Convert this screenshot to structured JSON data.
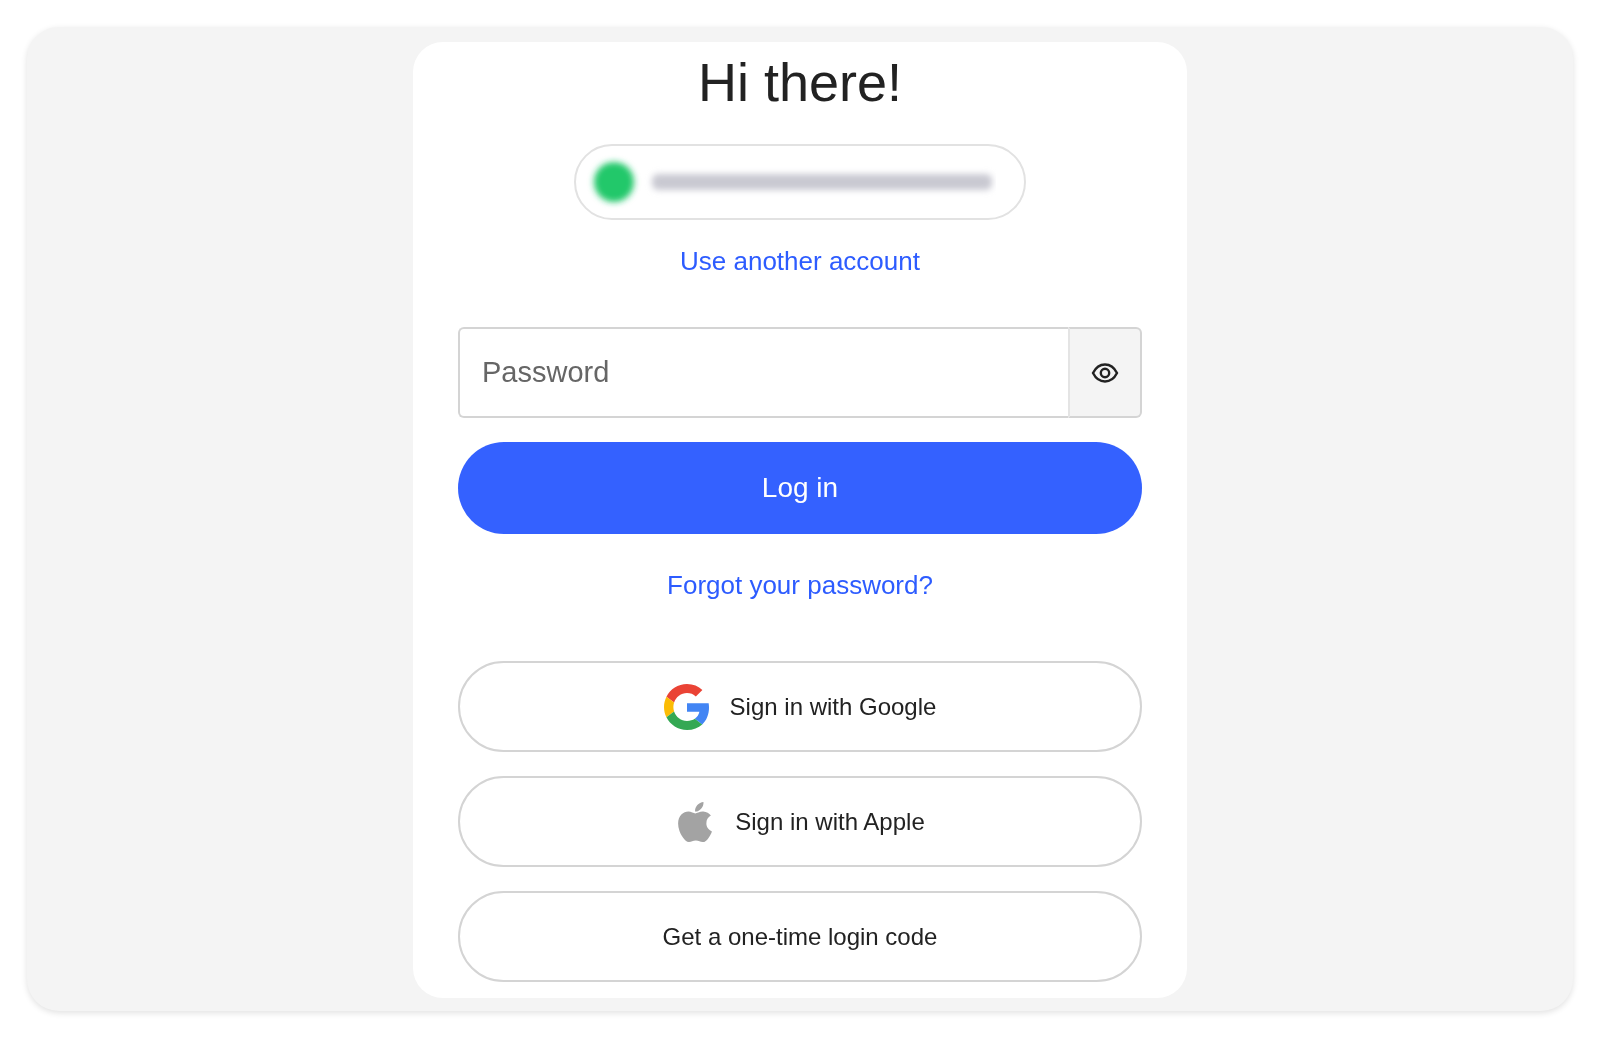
{
  "heading": "Hi there!",
  "switch_account_link": "Use another account",
  "password_field": {
    "placeholder": "Password"
  },
  "login_button": "Log in",
  "forgot_link": "Forgot your password?",
  "alt_sign_in": [
    {
      "kind": "google",
      "label": "Sign in with Google"
    },
    {
      "kind": "apple",
      "label": "Sign in with Apple"
    },
    {
      "kind": "code",
      "label": "Get a one-time login code"
    }
  ]
}
